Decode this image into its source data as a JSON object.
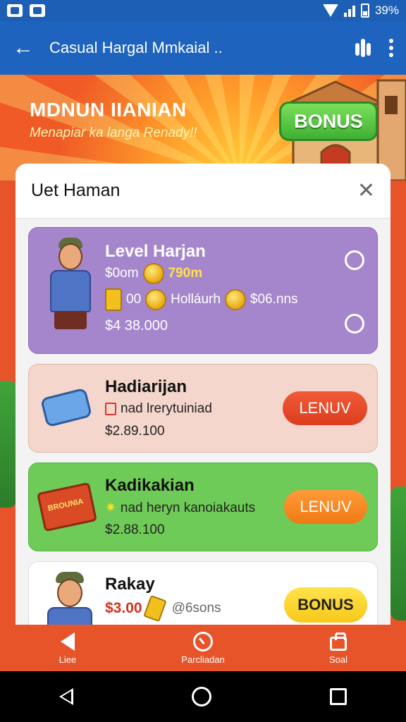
{
  "status_bar": {
    "battery": "39%"
  },
  "app_bar": {
    "title": "Casual Hargal Mmkaial .."
  },
  "hero": {
    "title": "MDNUN IIANIAN",
    "subtitle": "Menapiar ka langa Renady!!",
    "bonus_label": "BONUS"
  },
  "modal": {
    "title": "Uet Haman",
    "cards": [
      {
        "title": "Level Harjan",
        "line1_a": "$0om",
        "line1_b": "790m",
        "line2_a": "00",
        "line2_b": "Holláurh",
        "line2_c": "$06.nns",
        "price": "$4 38.000"
      },
      {
        "title": "Hadiarijan",
        "desc": "nad lrerytuiniad",
        "price": "$2.89.100",
        "button": "LENUV"
      },
      {
        "title": "Kadikakian",
        "desc": "nad heryn kanoiakauts",
        "price": "$2.88.100",
        "button": "LENUV",
        "book_label": "BROUNIA"
      },
      {
        "title": "Rakay",
        "price": "$3.00",
        "desc": "@6sons",
        "button": "BONUS"
      }
    ]
  },
  "bottom_nav": [
    {
      "label": "Liee"
    },
    {
      "label": "Parcliadan"
    },
    {
      "label": "Soal"
    }
  ]
}
